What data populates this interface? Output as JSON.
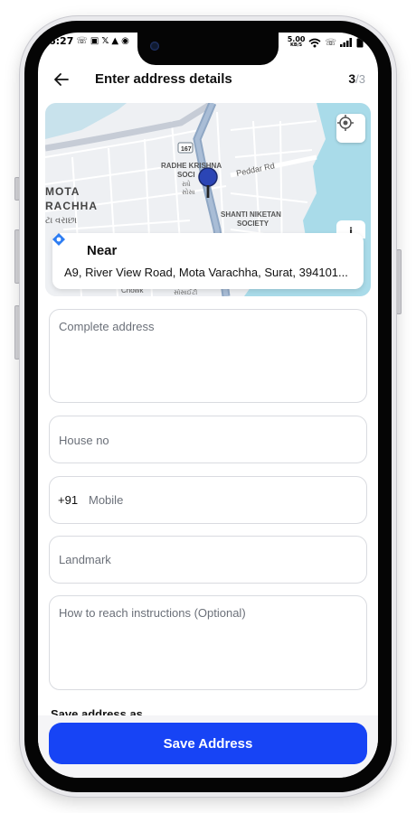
{
  "status_bar": {
    "time": "6:27",
    "network_speed": "5.00",
    "network_unit": "KB/S"
  },
  "header": {
    "title": "Enter address details",
    "step_current": "3",
    "step_total": "/3"
  },
  "map": {
    "labels": {
      "route_number": "167",
      "radhe_krishna": "RADHE KRISHNA",
      "soci": "SOCI",
      "radhe_gujarati": "રાધે",
      "sosa_gujarati": "સોસા",
      "peddar_rd": "Peddar Rd",
      "mota": "MOTA",
      "rachha": "RACHHA",
      "varachha_gujarati": "ટા વરાછા",
      "shanti_niketan": "SHANTI NIKETAN",
      "society": "SOCIETY",
      "chowk": "Chowk",
      "society_gujarati": "સોસાઈટી"
    },
    "colors": {
      "water": "#a9dbe9",
      "road": "#ffffff",
      "highway": "#8fa7c4",
      "land": "#eef0f3",
      "pin": "#2b45b5"
    }
  },
  "near_card": {
    "label": "Near",
    "address": "A9, River View Road, Mota Varachha, Surat, 394101..."
  },
  "form": {
    "complete_address_placeholder": "Complete address",
    "house_no_placeholder": "House no",
    "mobile_prefix": "+91",
    "mobile_placeholder": "Mobile",
    "landmark_placeholder": "Landmark",
    "instructions_placeholder": "How to reach instructions (Optional)"
  },
  "save_as_label": "Save address as",
  "save_button_label": "Save Address",
  "colors": {
    "accent": "#1744f5"
  }
}
